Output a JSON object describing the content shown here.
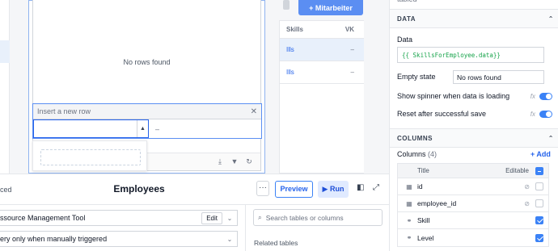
{
  "canvas": {
    "add_employee_button": "+ Mitarbeiter",
    "bg_table": {
      "headers": [
        "Skills",
        "VK"
      ],
      "rows": [
        {
          "skills": "Ills",
          "vk": "–"
        },
        {
          "skills": "Ills",
          "vk": "–"
        }
      ]
    },
    "widget": {
      "empty_text": "No rows found",
      "insert_title": "Insert a new row",
      "insert_close": "✕",
      "insert_dash": "–"
    }
  },
  "query": {
    "left_cut_label": "ced",
    "title": "Employees",
    "more_label": "···",
    "preview_label": "Preview",
    "run_label": "Run",
    "resource": "ssource Management Tool",
    "edit_label": "Edit",
    "trigger": "ery only when manually triggered",
    "search_placeholder": "Search tables or columns",
    "related_tables_label": "Related tables"
  },
  "panel": {
    "top_cut": "tabled",
    "data_section": "DATA",
    "data_label": "Data",
    "data_value": "{{ SkillsForEmployee.data}}",
    "empty_state_label": "Empty state",
    "empty_state_value": "No rows found",
    "spinner_label": "Show spinner when data is loading",
    "reset_label": "Reset after successful save",
    "fx_label": "fx",
    "columns_section": "COLUMNS",
    "columns_label": "Columns",
    "columns_count": "(4)",
    "add_label": "+ Add",
    "col_header_title": "Title",
    "col_header_editable": "Editable",
    "columns": [
      {
        "name": "id",
        "icon": "id-column-icon",
        "hidden": true,
        "editable": false
      },
      {
        "name": "employee_id",
        "icon": "id-column-icon",
        "hidden": true,
        "editable": false
      },
      {
        "name": "Skill",
        "icon": "link-column-icon",
        "hidden": false,
        "editable": true
      },
      {
        "name": "Level",
        "icon": "link-column-icon",
        "hidden": false,
        "editable": true
      }
    ]
  },
  "colors": {
    "accent": "#3b82f6",
    "primary_button": "#5b8ef2",
    "code_green": "#16a34a"
  }
}
